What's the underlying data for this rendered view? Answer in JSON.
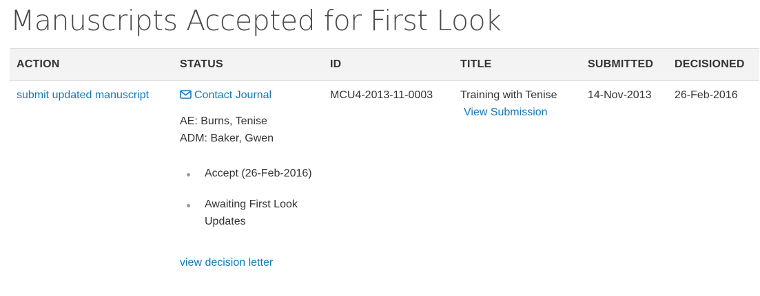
{
  "page": {
    "title": "Manuscripts Accepted for First Look"
  },
  "table": {
    "headers": {
      "action": "ACTION",
      "status": "STATUS",
      "id": "ID",
      "title": "TITLE",
      "submitted": "SUBMITTED",
      "decisioned": "DECISIONED"
    },
    "rows": [
      {
        "action_link": "submit updated manuscript",
        "status": {
          "contact_link": "Contact Journal",
          "contact_icon": "envelope-icon",
          "ae": "AE: Burns, Tenise",
          "adm": "ADM: Baker, Gwen",
          "history": [
            "Accept (26-Feb-2016)",
            "Awaiting First Look Updates"
          ],
          "decision_letter_link": "view decision letter"
        },
        "id": "MCU4-2013-11-0003",
        "title": "Training with Tenise",
        "view_submission_link": "View Submission",
        "submitted": "14-Nov-2013",
        "decisioned": "26-Feb-2016"
      }
    ]
  },
  "colors": {
    "link": "#1279b5",
    "header_bg": "#f3f3f3",
    "text": "#333333"
  }
}
